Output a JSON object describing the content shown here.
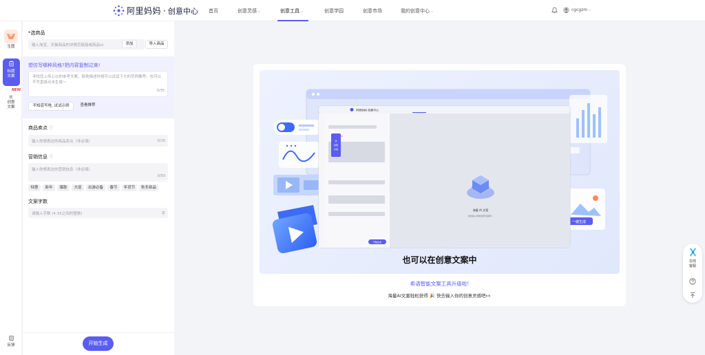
{
  "header": {
    "logo_text": "阿里妈妈",
    "logo_dot": "·",
    "logo_sub": "创意中心",
    "nav": [
      {
        "label": "首页",
        "chevron": false
      },
      {
        "label": "创意灵感",
        "chevron": true
      },
      {
        "label": "创意工具",
        "chevron": true,
        "active": true
      },
      {
        "label": "创意学园",
        "chevron": false
      },
      {
        "label": "创意市场",
        "chevron": false
      },
      {
        "label": "我的创意中心",
        "chevron": true
      }
    ],
    "username": "cgcgzm",
    "accent_color": "#5a5df0"
  },
  "rail": {
    "items": [
      "生图",
      "标题\n文案",
      "长\n创意\n文案"
    ],
    "new_badge": "NEW",
    "feedback": "反馈"
  },
  "form": {
    "product": {
      "title": "*选商品",
      "placeholder": "输入淘宝、天猫商品的详情页链接或商品id",
      "add_label": "添加",
      "import_label": "导入商品"
    },
    "style": {
      "title": "想仿写哪种风格?把内容复制过来!",
      "placeholder": "寻找您上传心仪的参考文案，按类描述时候可以试试下方的范例推荐，也可以不写直接点击生成～",
      "count": "0/35",
      "btn_example": "不知道写啥, 试试示例",
      "btn_recommend": "查看推荐"
    },
    "selling": {
      "title": "商品卖点",
      "placeholder": "输入你想表达的商品卖点（非必填）",
      "count": "0/16"
    },
    "marketing": {
      "title": "营销信息",
      "placeholder": "输入你想表达的营销信息（非必填）",
      "count": "0/50",
      "tags": [
        "特惠",
        "新年",
        "爆款",
        "大促",
        "出游必备",
        "春节",
        "年货节",
        "秋冬新品"
      ]
    },
    "wordcount": {
      "title": "文案字数",
      "placeholder": "请输入字数 (4-35之间的整数)",
      "unit": "字"
    },
    "generate_label": "开始生成"
  },
  "main": {
    "hero_caption": "也可以在创意文案中",
    "title": "希语智能文案工具升级啦!",
    "desc": "海量AI文案轻松获得 🎉 快去输入你的创意灵感吧👀",
    "mini_app": {
      "logo": "阿里妈妈 创意中心",
      "center_label": "海量 AI 文案",
      "center_sub": "快去输入你的创意灵感吧～",
      "start_label": "开始生成",
      "side_label": "长\n创意\n文案",
      "side_new": "NEW",
      "one_click": "一键生成"
    }
  },
  "float": {
    "service": "在线\n客服",
    "help_icon": "question-circle-icon",
    "top_icon": "back-to-top-icon"
  }
}
